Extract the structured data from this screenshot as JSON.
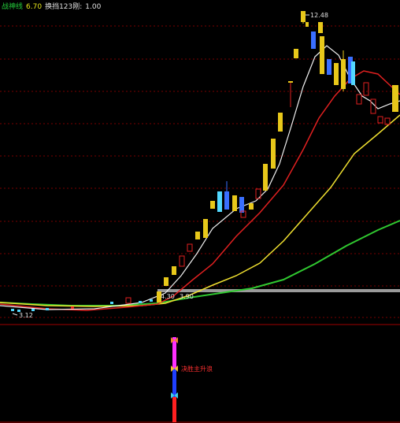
{
  "header": {
    "indicator_name": "战神线",
    "indicator_value": "6.70",
    "param_label": "换挡123刚:",
    "param_value": "1.00"
  },
  "annotations": {
    "high_label": "12.48",
    "low_label": "3.12",
    "flat_label_1": "4.30",
    "flat_label_2": "3.90",
    "signal_text": "决胜主升浪"
  },
  "colors": {
    "up_candle": "#e8c81a",
    "down_candle": "#3a6fff",
    "cyan_candle": "#52d8ff",
    "ma_white": "#f0f0f0",
    "ma_red": "#e02020",
    "ma_yellow": "#f0e030",
    "ma_green": "#30c830",
    "grid": "#7a0000",
    "bar_magenta": "#ff30ff",
    "bar_blue": "#1f3fff",
    "bar_red": "#ff2020",
    "signal_text": "#ff3030"
  },
  "icons": [
    "butterfly-icon",
    "butterfly-icon",
    "butterfly-icon"
  ]
}
